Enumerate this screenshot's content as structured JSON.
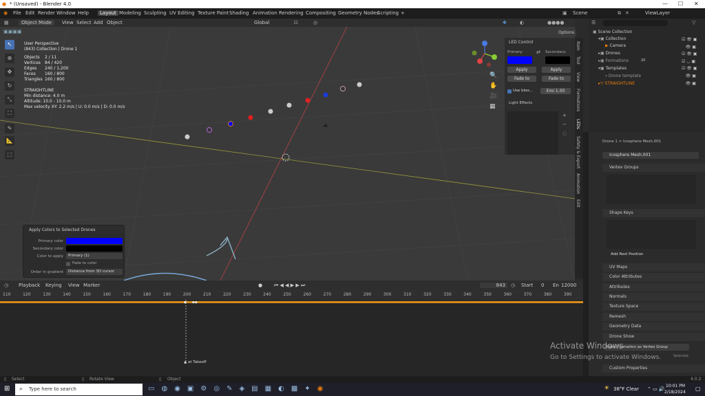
{
  "window": {
    "title": "* (Unsaved) - Blender 4.0",
    "min": "—",
    "max": "☐",
    "close": "✕"
  },
  "menu": {
    "file": "File",
    "edit": "Edit",
    "render": "Render",
    "window": "Window",
    "help": "Help"
  },
  "workspaces": [
    "Layout",
    "Modeling",
    "Sculpting",
    "UV Editing",
    "Texture Paint",
    "Shading",
    "Animation",
    "Rendering",
    "Compositing",
    "Geometry Nodes",
    "Scripting",
    "+"
  ],
  "scene": {
    "name": "Scene",
    "view_layer": "ViewLayer"
  },
  "viewport_header": {
    "mode": "Object Mode",
    "view": "View",
    "select": "Select",
    "add": "Add",
    "object": "Object",
    "orientation": "Global",
    "options": "Options"
  },
  "overlay": {
    "perspective": "User Perspective",
    "collection": "(843) Collection | Drone 1",
    "stats": [
      [
        "Objects",
        "2 / 11"
      ],
      [
        "Vertices",
        "84 / 420"
      ],
      [
        "Edges",
        "240 / 1,200"
      ],
      [
        "Faces",
        "160 / 800"
      ],
      [
        "Triangles",
        "160 / 800"
      ]
    ],
    "formation": "STRAIGHTLINE",
    "min_distance": "Min distance: 4.0 m",
    "altitude": "Altitude: 10.0 - 10.0 m",
    "max_velocity": "Max velocity XY: 2.2 m/s | U: 0.0 m/s | D: 0.0 m/s"
  },
  "led_panel": {
    "title": "LED Control",
    "primary_label": "Primary:",
    "secondary_label": "Secondary:",
    "primary_color": "#0000ff",
    "secondary_color": "#000000",
    "apply": "Apply",
    "fade_to": "Fade to",
    "use_bloom": "Use bloo...",
    "emission": "Emi  1.00",
    "light_effects": "Light Effects"
  },
  "vtabs": [
    "Item",
    "Tool",
    "View",
    "Formations",
    "LEDs",
    "Safety & Export",
    "Animation",
    "Edit"
  ],
  "outliner": {
    "root": "Scene Collection",
    "items": [
      {
        "name": "Collection",
        "indent": 1
      },
      {
        "name": "Camera",
        "indent": 2
      },
      {
        "name": "Drones",
        "indent": 1
      },
      {
        "name": "Formations",
        "indent": 1
      },
      {
        "name": "Templates",
        "indent": 1
      },
      {
        "name": "Drone template",
        "indent": 2
      },
      {
        "name": "STRAIGHTLINE",
        "indent": 1
      }
    ],
    "badge_20": "20"
  },
  "properties": {
    "breadcrumb": "Drone 1  >  Icosphere Mesh.001",
    "mesh_name": "Icosphere Mesh.001",
    "vertex_groups": "Vertex Groups",
    "shape_keys": "Shape Keys",
    "add_rest": "Add Rest Position",
    "sections": [
      "UV Maps",
      "Color Attributes",
      "Attributes",
      "Normals",
      "Texture Space",
      "Remesh",
      "Geometry Data",
      "Drone Show"
    ],
    "drone_show_item": "Make Formation as Vertex Group",
    "drone_show_item_right": "Selected",
    "custom_properties": "Custom Properties"
  },
  "redo_panel": {
    "title": "Apply Colors to Selected Drones",
    "primary": "Primary color",
    "secondary": "Secondary color",
    "color_to_apply": "Color to apply",
    "color_value": "Primary (1)",
    "fade_to_color": "Fade to color",
    "order": "Order in gradient",
    "order_value": "Distance from 3D cursor",
    "primary_swatch": "#0000ff",
    "secondary_swatch": "#000000"
  },
  "timeline": {
    "playback": "Playback",
    "keying": "Keying",
    "view": "View",
    "marker": "Marker",
    "frame": "843",
    "start_label": "Start",
    "start": "0",
    "end_label": "En",
    "end": "12000",
    "ticks": [
      "110",
      "120",
      "130",
      "140",
      "150",
      "160",
      "170",
      "180",
      "190",
      "200",
      "210",
      "220",
      "230",
      "240",
      "250",
      "260",
      "270",
      "280",
      "290",
      "300",
      "310",
      "320",
      "330",
      "340",
      "350",
      "360",
      "370",
      "380",
      "390"
    ],
    "marker_label": "at Takeoff"
  },
  "statusbar": {
    "select": "Select",
    "rotate": "Rotate View",
    "object": "Object",
    "version": "4.0.2"
  },
  "taskbar": {
    "search": "Type here to search",
    "weather": "38°F  Clear",
    "time": "10:01 PM",
    "date": "2/18/2024"
  },
  "watermark": {
    "line1": "Activate Windows",
    "line2": "Go to Settings to activate Windows."
  }
}
